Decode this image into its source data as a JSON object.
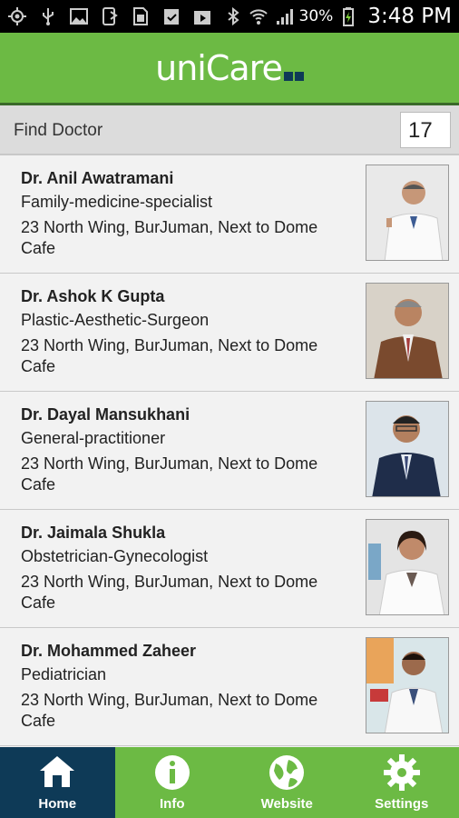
{
  "status_bar": {
    "battery_percent": "30%",
    "time": "3:48 PM",
    "left_icons": [
      "gps-icon",
      "usb-icon",
      "image-icon",
      "phone-forward-icon",
      "sim-icon",
      "clipboard-check-icon",
      "play-store-icon"
    ],
    "right_icons": [
      "bluetooth-icon",
      "wifi-icon",
      "signal-icon",
      "battery-charging-icon"
    ]
  },
  "header": {
    "logo_text": "uniCare",
    "logo_squares": [
      "#0e3a57",
      "#0e3a57"
    ],
    "background": "#6cba44"
  },
  "find_bar": {
    "label": "Find Doctor",
    "count": "17"
  },
  "doctors": [
    {
      "name": "Dr. Anil Awatramani",
      "specialty": "Family-medicine-specialist",
      "address": "23 North Wing, BurJuman, Next to Dome Cafe",
      "photo": "doctor-photo-white-coat"
    },
    {
      "name": "Dr. Ashok K Gupta",
      "specialty": "Plastic-Aesthetic-Surgeon",
      "address": "23 North Wing, BurJuman, Next to Dome Cafe",
      "photo": "doctor-photo-brown-suit"
    },
    {
      "name": "Dr. Dayal Mansukhani",
      "specialty": "General-practitioner",
      "address": "23 North Wing, BurJuman, Next to Dome Cafe",
      "photo": "doctor-photo-dark-suit"
    },
    {
      "name": "Dr. Jaimala Shukla",
      "specialty": "Obstetrician-Gynecologist",
      "address": "23 North Wing, BurJuman, Next to Dome Cafe",
      "photo": "doctor-photo-white-coat-female"
    },
    {
      "name": "Dr. Mohammed Zaheer",
      "specialty": "Pediatrician",
      "address": "23 North Wing, BurJuman, Next to Dome Cafe",
      "photo": "doctor-photo-white-coat-clinic"
    }
  ],
  "bottom_nav": {
    "active_color": "#0e3a57",
    "items": [
      {
        "label": "Home",
        "icon": "home-icon",
        "active": true
      },
      {
        "label": "Info",
        "icon": "info-icon",
        "active": false
      },
      {
        "label": "Website",
        "icon": "globe-icon",
        "active": false
      },
      {
        "label": "Settings",
        "icon": "gear-icon",
        "active": false
      }
    ]
  }
}
